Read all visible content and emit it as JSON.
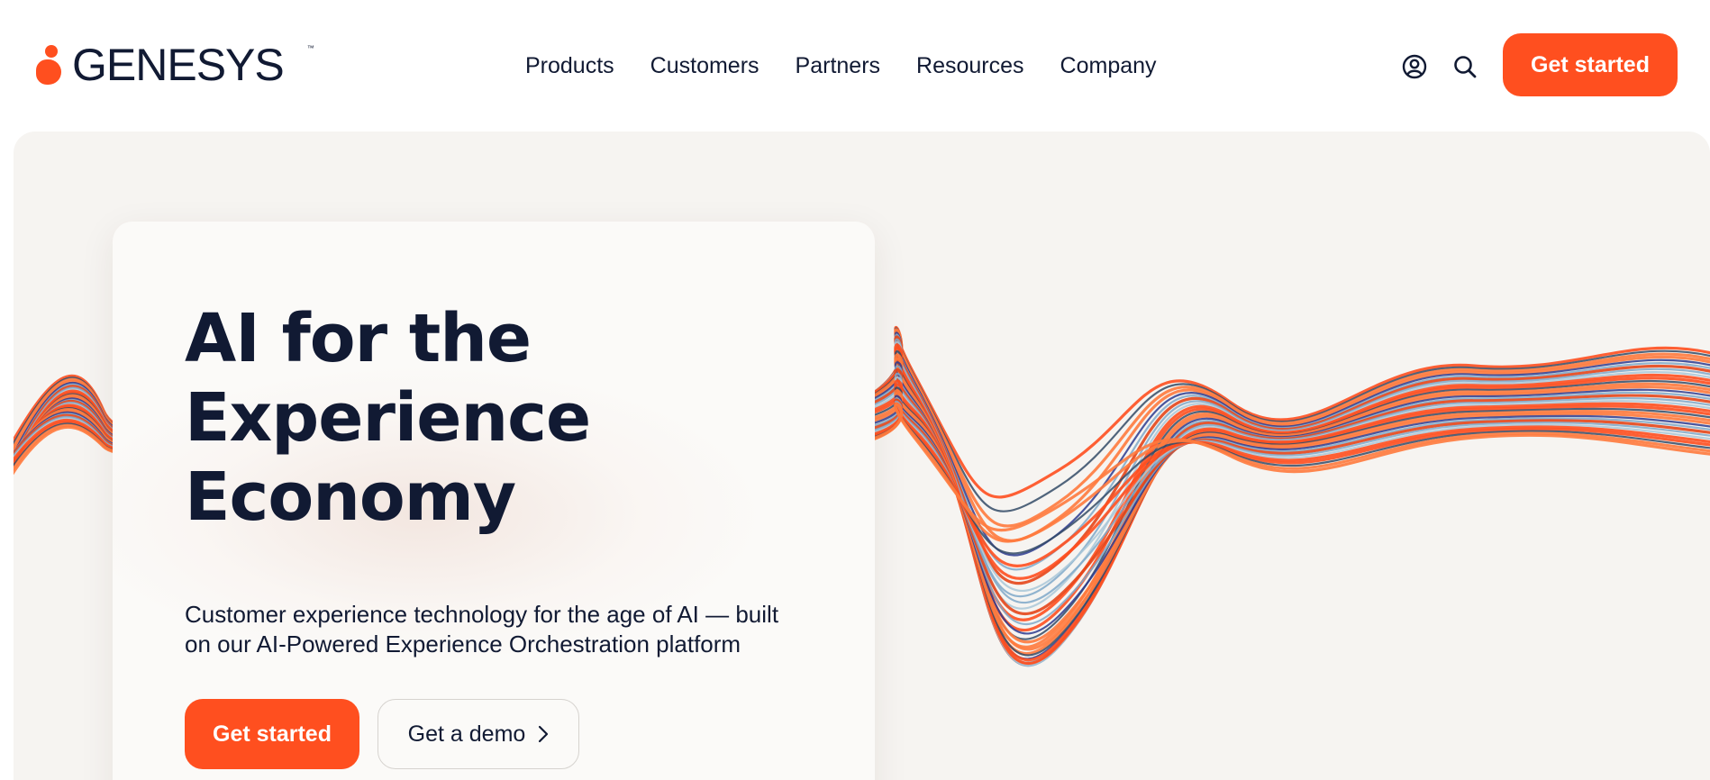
{
  "header": {
    "logo_text": "GENESYS",
    "logo_tm": "™",
    "nav": [
      "Products",
      "Customers",
      "Partners",
      "Resources",
      "Company"
    ],
    "account_icon": "user-circle-icon",
    "search_icon": "search-icon",
    "cta_label": "Get started"
  },
  "hero": {
    "title_lines": [
      "AI for the",
      "Experience",
      "Economy"
    ],
    "subtitle_lines": [
      "Customer experience technology for the age of AI — built",
      "on our AI-Powered Experience Orchestration platform"
    ],
    "primary_cta": "Get started",
    "secondary_cta": "Get a demo",
    "secondary_cta_icon": "chevron-right-icon"
  },
  "colors": {
    "accent": "#ff4f1f",
    "text": "#111a33",
    "hero_bg": "#f6f4f1",
    "card_bg": "#fbfaf8",
    "wave_palette": [
      "#ff4f1f",
      "#ff7a3d",
      "#e6461a",
      "#2b3a8f",
      "#7fa8c9",
      "#a9c7d8",
      "#334a66"
    ]
  }
}
